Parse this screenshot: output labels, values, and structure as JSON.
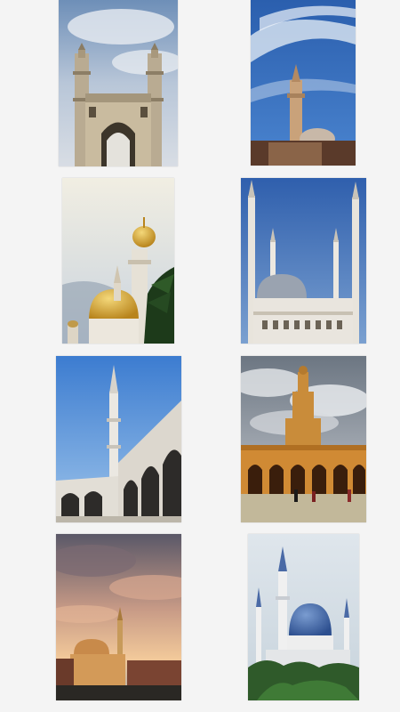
{
  "gallery": {
    "items": [
      {
        "subject": "charminar-minaret-arch"
      },
      {
        "subject": "single-minaret-blue-sky"
      },
      {
        "subject": "golden-dome-palm"
      },
      {
        "subject": "white-mosque-many-minarets"
      },
      {
        "subject": "mosque-courtyard-arcade"
      },
      {
        "subject": "spiral-minaret-courtyard"
      },
      {
        "subject": "sunset-mosque-silhouette"
      },
      {
        "subject": "blue-dome-mosque"
      }
    ]
  },
  "colors": {
    "background": "#f4f4f4",
    "sky_blue": "#3a6fb8",
    "stone": "#d9c9a8",
    "gold": "#d9a530",
    "sunset": "#e9b07a"
  }
}
